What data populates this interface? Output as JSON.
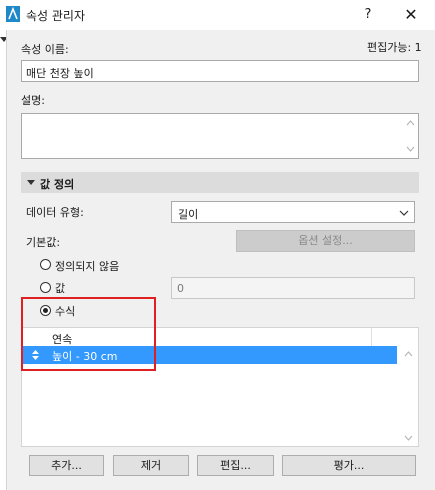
{
  "window": {
    "title": "속성 관리자",
    "help_label": "?",
    "close_label": "✕"
  },
  "property_name": {
    "label": "속성 이름:",
    "editable_text": "편집가능: 1",
    "value": "매단 천장 높이"
  },
  "description": {
    "label": "설명:",
    "value": ""
  },
  "value_definition": {
    "header": "값 정의",
    "data_type_label": "데이터 유형:",
    "data_type_value": "길이",
    "default_label": "기본값:",
    "options_button": "옵션 설정...",
    "radio_undefined": "정의되지 않음",
    "radio_value": "값",
    "value_field": "0",
    "radio_formula": "수식",
    "selected_radio": "수식"
  },
  "table": {
    "column_header": "연속",
    "rows": [
      {
        "text": "높이 - 30 cm",
        "selected": true
      }
    ]
  },
  "buttons": {
    "add": "추가...",
    "remove": "제거",
    "edit": "편집...",
    "evaluate": "평가..."
  },
  "colors": {
    "selection": "#3399ff",
    "annotation": "#e02020"
  }
}
